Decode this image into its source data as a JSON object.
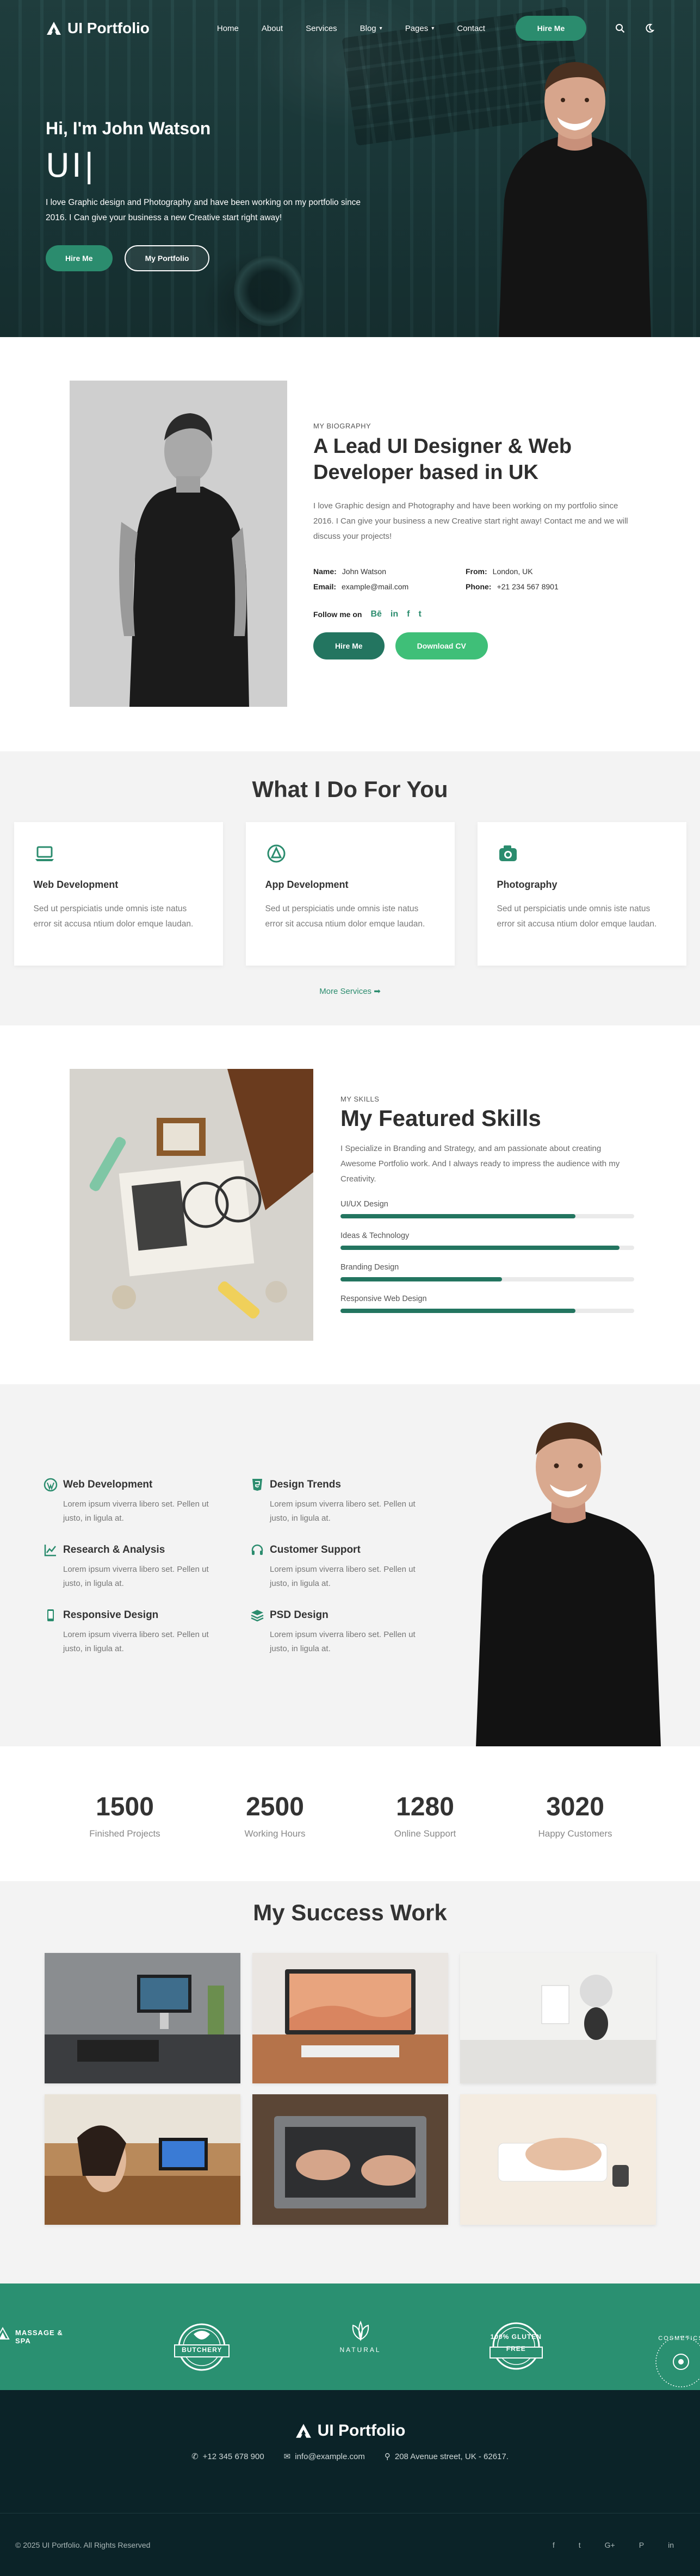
{
  "brand": {
    "name": "UI Portfolio",
    "accent": "#2b8c6e",
    "dark": "#0b2328"
  },
  "nav": {
    "items": [
      "Home",
      "About",
      "Services",
      "Blog",
      "Pages",
      "Contact"
    ],
    "hire_label": "Hire Me",
    "search_icon": "search-icon",
    "theme_icon": "moon-icon"
  },
  "hero": {
    "greeting": "Hi, I'm John Watson",
    "typing": "UI|",
    "description": "I love Graphic design and Photography and have been working on my portfolio since 2016. I Can give your business a new Creative start right away!",
    "hire_label": "Hire Me",
    "portfolio_label": "My Portfolio"
  },
  "about": {
    "kicker": "MY BIOGRAPHY",
    "title": "A Lead UI Designer & Web Developer based in UK",
    "description": "I love Graphic design and Photography and have been working on my portfolio since 2016. I Can give your business a new Creative start right away! Contact me and we will discuss your projects!",
    "name_label": "Name:",
    "name_value": "John Watson",
    "from_label": "From:",
    "from_value": "London, UK",
    "email_label": "Email:",
    "email_value": "example@mail.com",
    "phone_label": "Phone:",
    "phone_value": "+21 234 567 8901",
    "follow_label": "Follow me on",
    "social": [
      "Bē",
      "in",
      "f",
      "t"
    ],
    "hire_label": "Hire Me",
    "cv_label": "Download CV"
  },
  "services": {
    "title": "What I Do For You",
    "cards": [
      {
        "title": "Web Development",
        "icon": "laptop-icon",
        "text": "Sed ut perspiciatis unde omnis iste natus error sit accusa ntium dolor emque laudan."
      },
      {
        "title": "App Development",
        "icon": "app-icon",
        "text": "Sed ut perspiciatis unde omnis iste natus error sit accusa ntium dolor emque laudan."
      },
      {
        "title": "Photography",
        "icon": "camera-icon",
        "text": "Sed ut perspiciatis unde omnis iste natus error sit accusa ntium dolor emque laudan."
      }
    ],
    "more_label": "More Services ➡"
  },
  "skills": {
    "kicker": "MY SKILLS",
    "title": "My Featured Skills",
    "description": "I Specialize in Branding and Strategy, and am passionate about creating Awesome Portfolio work. And I always ready to impress the audience with my Creativity.",
    "items": [
      {
        "label": "UI/UX Design",
        "percent": 80
      },
      {
        "label": "Ideas & Technology",
        "percent": 95
      },
      {
        "label": "Branding Design",
        "percent": 55
      },
      {
        "label": "Responsive Web Design",
        "percent": 80
      }
    ]
  },
  "features": {
    "items": [
      {
        "title": "Web Development",
        "icon": "wordpress-icon",
        "text": "Lorem ipsum viverra libero set. Pellen ut justo, in ligula at."
      },
      {
        "title": "Design Trends",
        "icon": "html5-icon",
        "text": "Lorem ipsum viverra libero set. Pellen ut justo, in ligula at."
      },
      {
        "title": "Research & Analysis",
        "icon": "chart-line-icon",
        "text": "Lorem ipsum viverra libero set. Pellen ut justo, in ligula at."
      },
      {
        "title": "Customer Support",
        "icon": "headset-icon",
        "text": "Lorem ipsum viverra libero set. Pellen ut justo, in ligula at."
      },
      {
        "title": "Responsive Design",
        "icon": "mobile-icon",
        "text": "Lorem ipsum viverra libero set. Pellen ut justo, in ligula at."
      },
      {
        "title": "PSD Design",
        "icon": "layers-icon",
        "text": "Lorem ipsum viverra libero set. Pellen ut justo, in ligula at."
      }
    ]
  },
  "counters": [
    {
      "value": "1500",
      "label": "Finished Projects"
    },
    {
      "value": "2500",
      "label": "Working Hours"
    },
    {
      "value": "1280",
      "label": "Online Support"
    },
    {
      "value": "3020",
      "label": "Happy Customers"
    }
  ],
  "portfolio": {
    "title": "My Success Work"
  },
  "clients": {
    "logos": [
      "MASSAGE & SPA",
      "BUTCHERY",
      "NATURAL",
      "100% GLUTEN FREE",
      "COSMETICS"
    ]
  },
  "footer": {
    "brand": "UI Portfolio",
    "phone": "+12 345 678 900",
    "email": "info@example.com",
    "address": "208 Avenue street, UK - 62617.",
    "copyright": "© 2025 UI Portfolio. All Rights Reserved",
    "social": [
      "f",
      "t",
      "G+",
      "P",
      "in"
    ]
  }
}
